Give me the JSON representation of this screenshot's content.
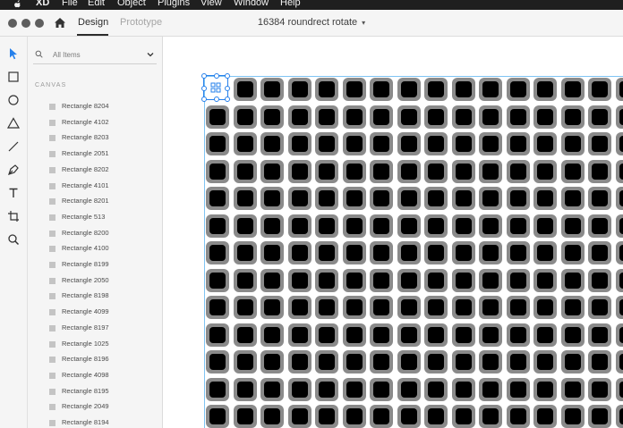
{
  "menubar": {
    "items": [
      "XD",
      "File",
      "Edit",
      "Object",
      "Plugins",
      "View",
      "Window",
      "Help"
    ]
  },
  "titlebar": {
    "tabs": [
      {
        "label": "Design",
        "active": true
      },
      {
        "label": "Prototype",
        "active": false
      }
    ],
    "document_title": "16384 roundrect rotate"
  },
  "toolbar": {
    "tools": [
      "select-icon",
      "rectangle-icon",
      "ellipse-icon",
      "polygon-icon",
      "line-icon",
      "pen-icon",
      "text-icon",
      "artboard-icon",
      "zoom-icon"
    ]
  },
  "layers": {
    "search_placeholder": "All Items",
    "section_label": "CANVAS",
    "items": [
      "Rectangle 8204",
      "Rectangle 4102",
      "Rectangle 8203",
      "Rectangle 2051",
      "Rectangle 8202",
      "Rectangle 4101",
      "Rectangle 8201",
      "Rectangle 513",
      "Rectangle 8200",
      "Rectangle 4100",
      "Rectangle 8199",
      "Rectangle 2050",
      "Rectangle 8198",
      "Rectangle 4099",
      "Rectangle 8197",
      "Rectangle 1025",
      "Rectangle 8196",
      "Rectangle 4098",
      "Rectangle 8195",
      "Rectangle 2049",
      "Rectangle 8194"
    ]
  },
  "canvas": {
    "grid_cell_colors": {
      "outer": "#8a8a8a",
      "inner": "#000000"
    },
    "selection_color": "#2680eb"
  }
}
